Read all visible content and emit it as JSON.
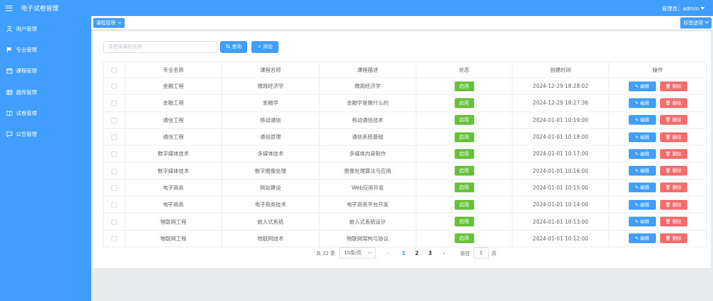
{
  "app": {
    "title": "电子试卷管理"
  },
  "header": {
    "user_label": "管理员：admin"
  },
  "sidebar": {
    "items": [
      {
        "label": "用户管理",
        "icon": "user-icon"
      },
      {
        "label": "专业管理",
        "icon": "flag-icon"
      },
      {
        "label": "课程管理",
        "icon": "calendar-icon"
      },
      {
        "label": "题库管理",
        "icon": "database-icon"
      },
      {
        "label": "试卷管理",
        "icon": "book-icon"
      },
      {
        "label": "公告管理",
        "icon": "chat-icon"
      }
    ]
  },
  "tags": {
    "active": "课程管理",
    "options_label": "标签选项"
  },
  "toolbar": {
    "search_placeholder": "请选择课程名称",
    "query_label": "查询",
    "add_label": "添加"
  },
  "table": {
    "columns": [
      "专业名称",
      "课程名称",
      "课程描述",
      "状态",
      "创建时间",
      "操作"
    ],
    "rows": [
      {
        "major": "金融工程",
        "course": "微观经济学",
        "desc": "微观经济学",
        "status": "启用",
        "created": "2024-12-29 18:28:02"
      },
      {
        "major": "金融工程",
        "course": "金融学",
        "desc": "金融学是做什么的",
        "status": "启用",
        "created": "2024-12-29 18:27:36"
      },
      {
        "major": "通信工程",
        "course": "移动通信",
        "desc": "移动通信技术",
        "status": "启用",
        "created": "2024-01-01 10:19:00"
      },
      {
        "major": "通信工程",
        "course": "通信原理",
        "desc": "通信系统基础",
        "status": "启用",
        "created": "2024-01-01 10:18:00"
      },
      {
        "major": "数字媒体技术",
        "course": "多媒体技术",
        "desc": "多媒体内容制作",
        "status": "启用",
        "created": "2024-01-01 10:17:00"
      },
      {
        "major": "数字媒体技术",
        "course": "数字图像处理",
        "desc": "图像处理算法与应用",
        "status": "启用",
        "created": "2024-01-01 10:16:00"
      },
      {
        "major": "电子商务",
        "course": "网站建设",
        "desc": "Web应用开发",
        "status": "启用",
        "created": "2024-01-01 10:15:00"
      },
      {
        "major": "电子商务",
        "course": "电子商务技术",
        "desc": "电子商务平台开发",
        "status": "启用",
        "created": "2024-01-01 10:14:00"
      },
      {
        "major": "物联网工程",
        "course": "嵌入式系统",
        "desc": "嵌入式系统设计",
        "status": "启用",
        "created": "2024-01-01 10:13:00"
      },
      {
        "major": "物联网工程",
        "course": "物联网技术",
        "desc": "物联网架构与协议",
        "status": "启用",
        "created": "2024-01-01 10:12:00"
      }
    ],
    "edit_label": "编辑",
    "delete_label": "删除"
  },
  "pagination": {
    "total": "共 22 条",
    "page_size": "10条/页",
    "pages": [
      "1",
      "2",
      "3"
    ],
    "current": "1",
    "goto_label": "前往",
    "goto_value": "1",
    "page_suffix": "页"
  },
  "colors": {
    "primary": "#409eff",
    "success": "#67c23a",
    "danger": "#f56c6c"
  }
}
